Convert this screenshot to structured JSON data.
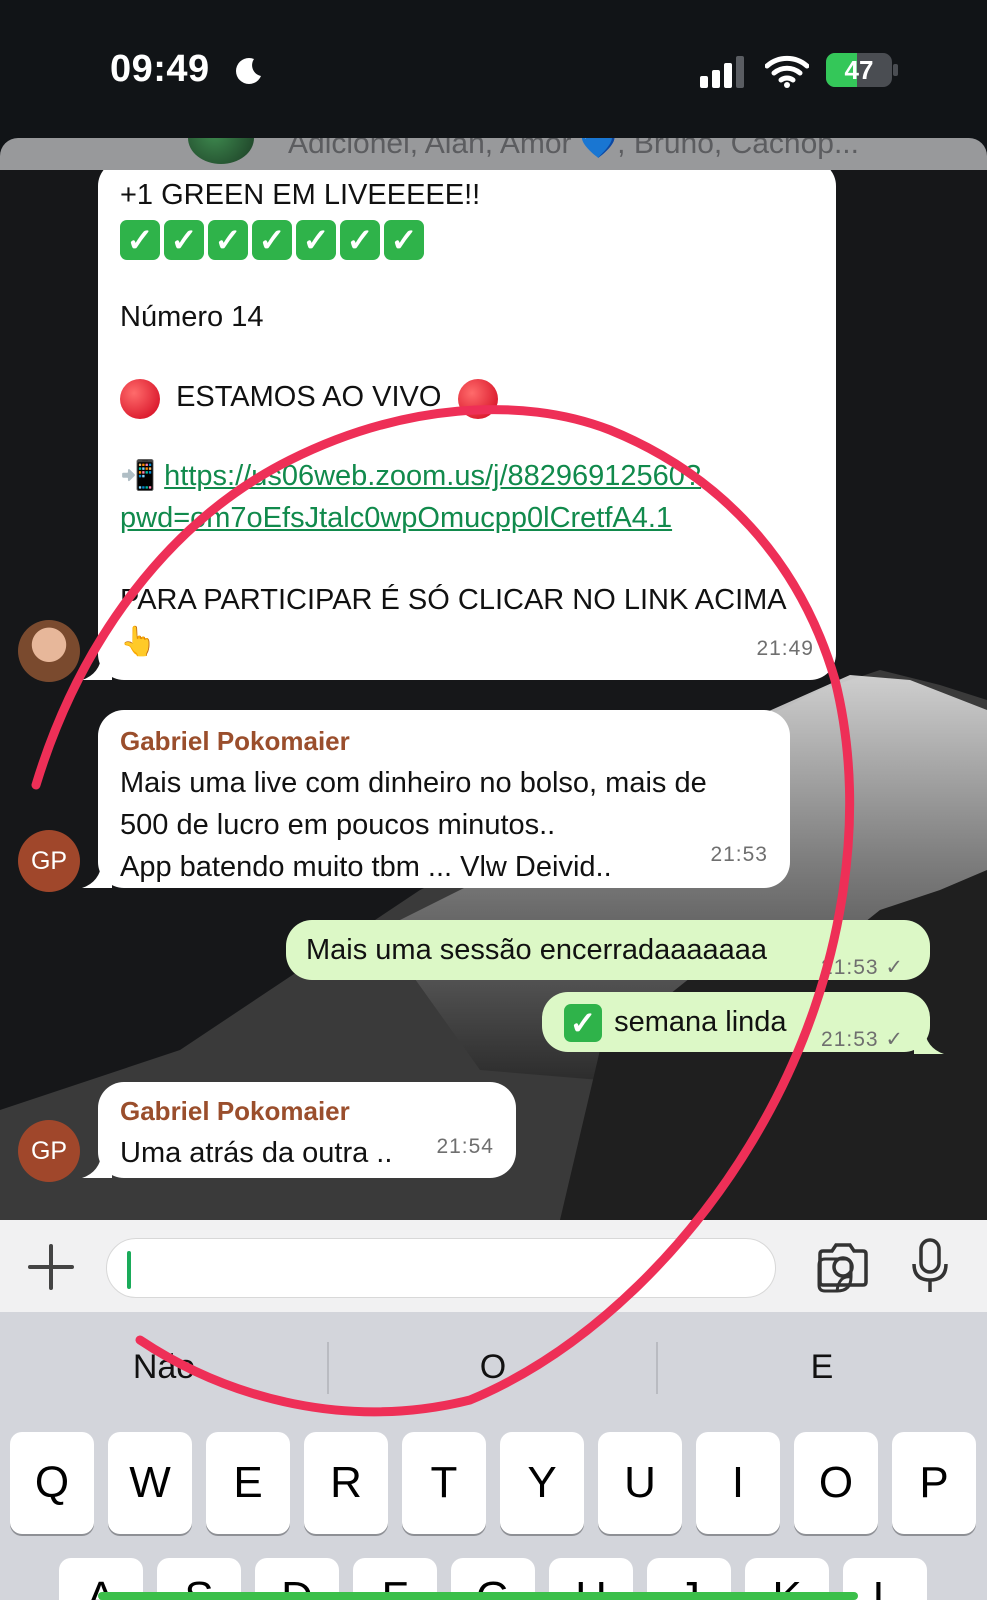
{
  "status_bar": {
    "time": "09:49",
    "battery": "47",
    "battery_level": 0.47,
    "icons": [
      "moon-icon",
      "signal-icon",
      "wifi-icon",
      "battery-charging-icon"
    ]
  },
  "header": {
    "participants": "Adicionei, Alan, Amor 💙, Bruno, Cachop..."
  },
  "messages": [
    {
      "direction": "in",
      "line1": "+1 GREEN EM LIVEEEEE!!",
      "checks": [
        "✓",
        "✓",
        "✓",
        "✓",
        "✓",
        "✓",
        "✓"
      ],
      "line2": "Número 14",
      "line3": "ESTAMOS AO VIVO",
      "link_line1": "https://us06web.zoom.us/j/88296912560?",
      "link_line2": "pwd=om7oEfsJtalc0wpOmucpp0lCretfA4.1",
      "line4": "PARA PARTICIPAR É SÓ CLICAR NO LINK ACIMA",
      "emoji": "👆",
      "time": "21:49"
    },
    {
      "direction": "in",
      "sender": "Gabriel Pokomaier",
      "avatar": "GP",
      "lines": [
        "Mais uma live com dinheiro no bolso, mais de",
        "500 de lucro em poucos minutos..",
        "App batendo muito tbm ... Vlw Deivid.."
      ],
      "time": "21:53"
    },
    {
      "direction": "out",
      "text": "Mais uma sessão encerradaaaaaaa",
      "time": "21:53 ✓"
    },
    {
      "direction": "out",
      "check": "✓",
      "text": "semana linda",
      "time": "21:53 ✓"
    },
    {
      "direction": "in",
      "sender": "Gabriel Pokomaier",
      "avatar": "GP",
      "text": "Uma atrás da outra ..",
      "time": "21:54"
    }
  ],
  "input": {
    "value": ""
  },
  "keyboard": {
    "suggestions": [
      "Não",
      "O",
      "E"
    ],
    "row1": [
      "Q",
      "W",
      "E",
      "R",
      "T",
      "Y",
      "U",
      "I",
      "O",
      "P"
    ],
    "row2": [
      "A",
      "S",
      "D",
      "F",
      "G",
      "H",
      "J",
      "K",
      "L"
    ]
  },
  "colors": {
    "outgoing_bubble": "#dcf8c6",
    "sender_name": "#9a4e2c",
    "link": "#118a4c",
    "annotation_circle": "#ee2f57"
  }
}
